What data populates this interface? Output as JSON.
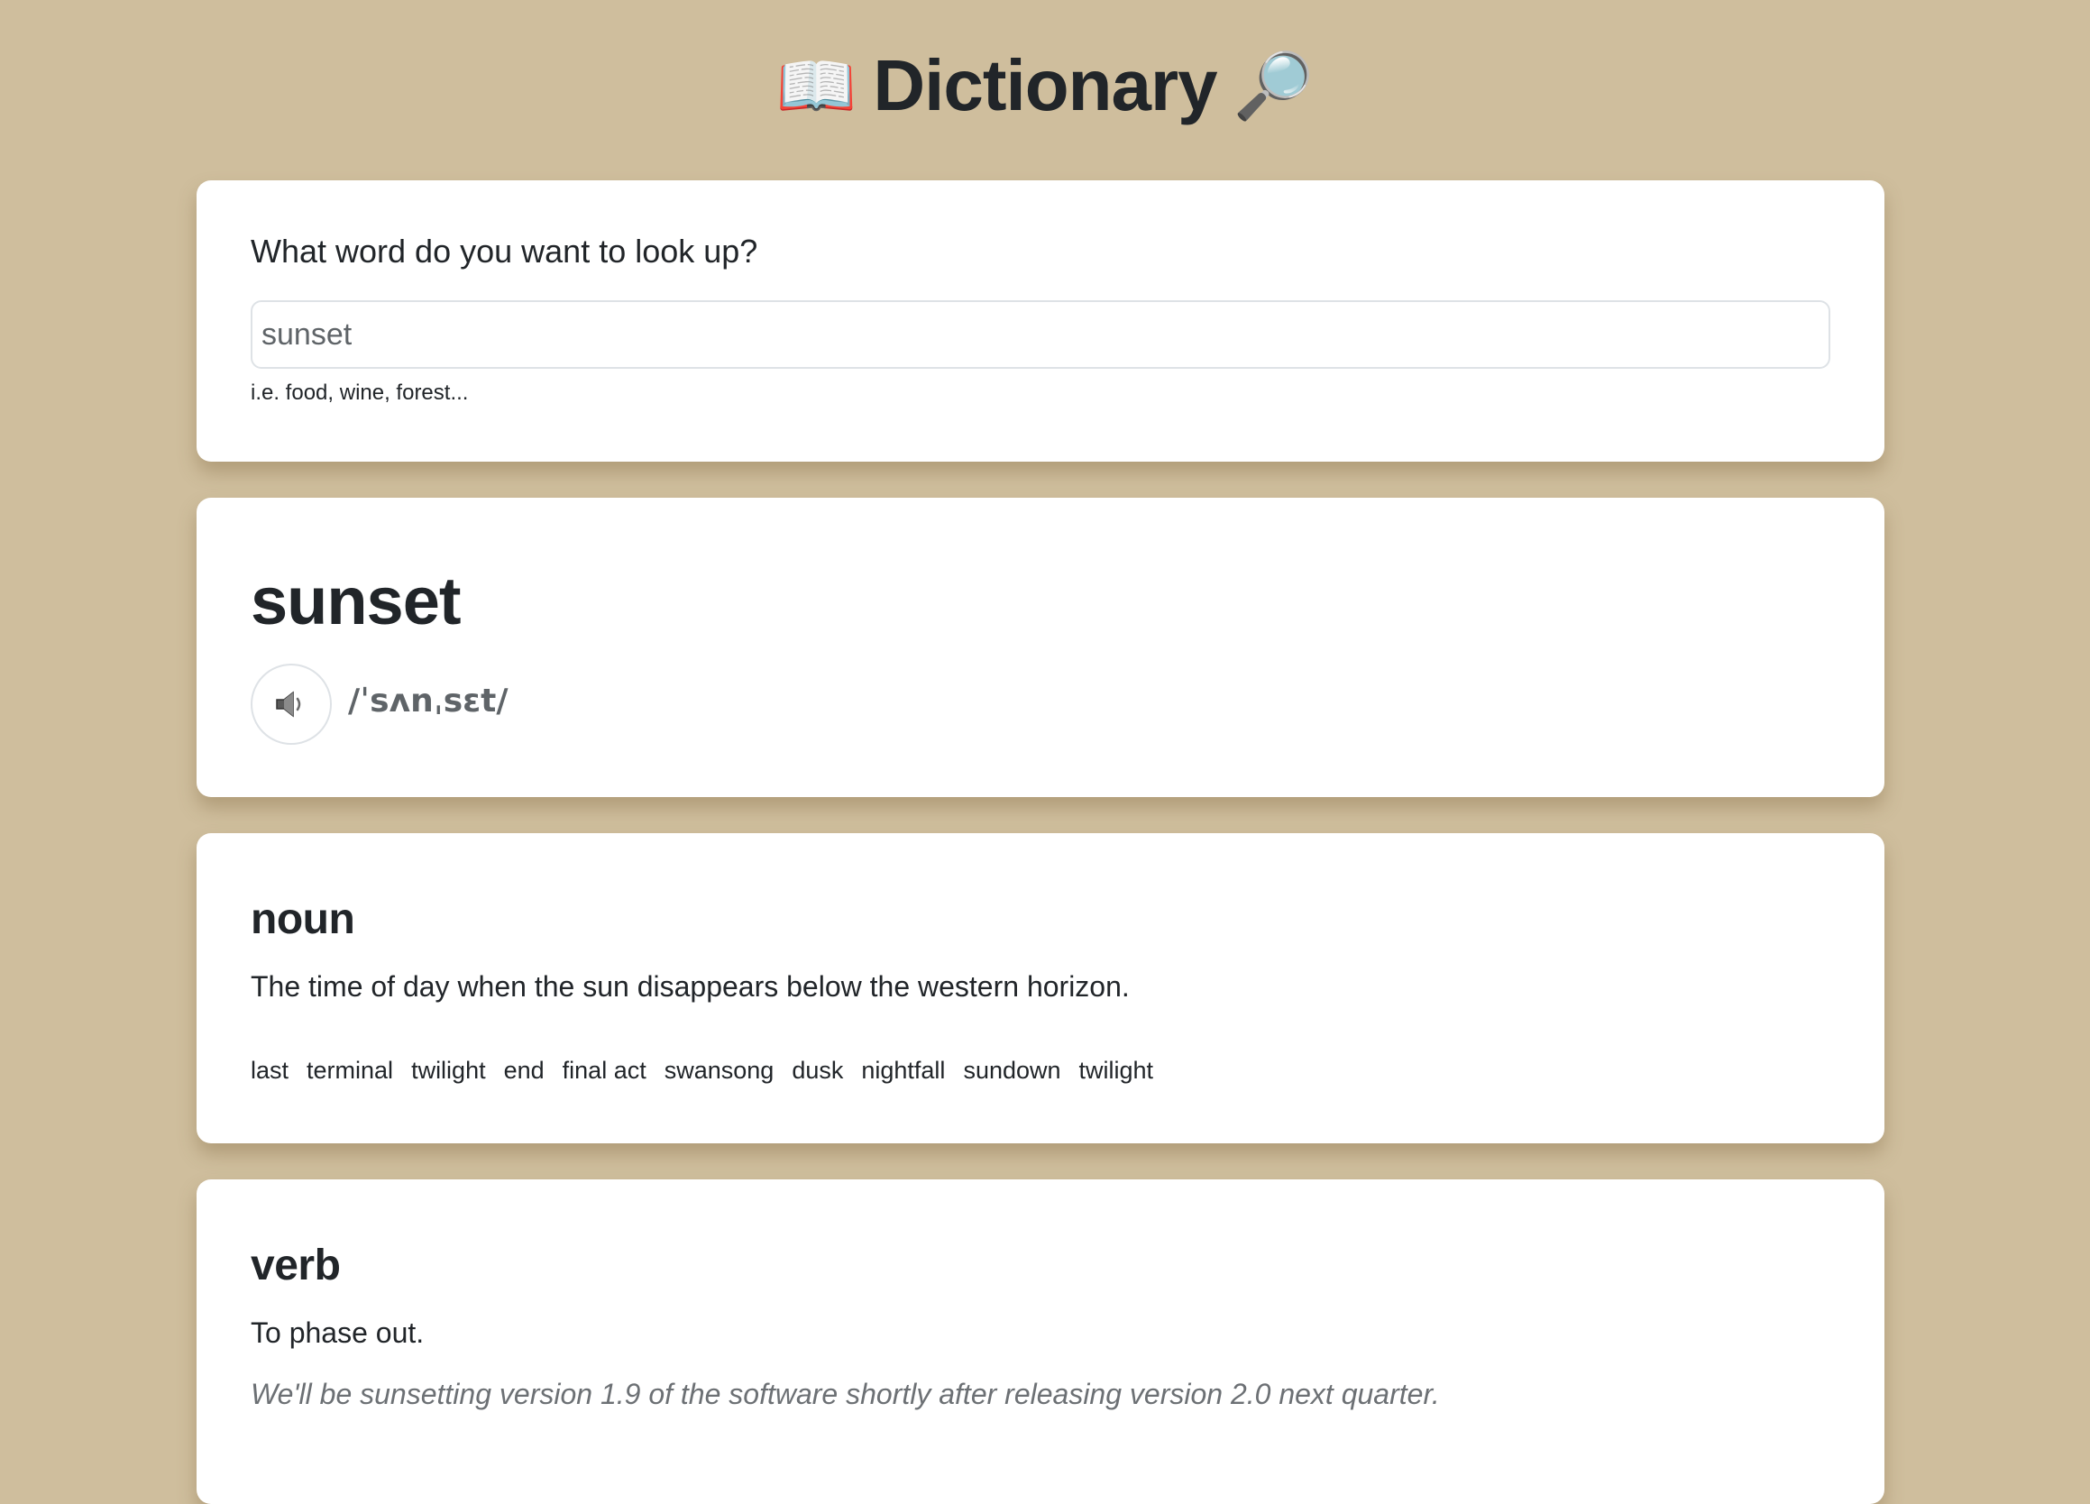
{
  "header": {
    "title": "Dictionary",
    "left_icon": "open-book-emoji",
    "left_glyph": "📖",
    "right_icon": "magnifying-glass-emoji",
    "right_glyph": "🔎"
  },
  "search": {
    "label": "What word do you want to look up?",
    "value": "sunset",
    "hint": "i.e. food, wine, forest..."
  },
  "word": {
    "text": "sunset",
    "phonetic": "/ˈsʌnˌsɛt/",
    "audio_icon": "speaker-icon"
  },
  "meanings": [
    {
      "part_of_speech": "noun",
      "definition": "The time of day when the sun disappears below the western horizon.",
      "synonyms": [
        "last",
        "terminal",
        "twilight",
        "end",
        "final act",
        "swansong",
        "dusk",
        "nightfall",
        "sundown",
        "twilight"
      ]
    },
    {
      "part_of_speech": "verb",
      "definition": "To phase out.",
      "example": "We'll be sunsetting version 1.9 of the software shortly after releasing version 2.0 next quarter."
    }
  ],
  "colors": {
    "background": "#cfbe9d",
    "card": "#ffffff",
    "text": "#212529",
    "muted": "#6c7074"
  }
}
